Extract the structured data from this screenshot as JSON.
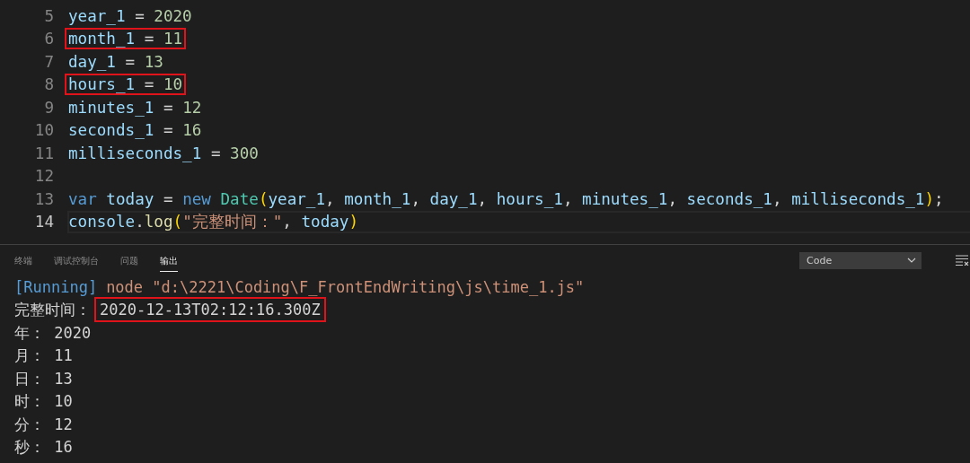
{
  "editor": {
    "lines": [
      {
        "number": "5",
        "highlighted": false,
        "current": false,
        "tokens": [
          {
            "kind": "var",
            "text": "year_1"
          },
          {
            "kind": "op",
            "text": " = "
          },
          {
            "kind": "num",
            "text": "2020"
          }
        ]
      },
      {
        "number": "6",
        "highlighted": true,
        "current": false,
        "tokens": [
          {
            "kind": "var",
            "text": "month_1"
          },
          {
            "kind": "op",
            "text": " = "
          },
          {
            "kind": "num",
            "text": "11"
          }
        ]
      },
      {
        "number": "7",
        "highlighted": false,
        "current": false,
        "tokens": [
          {
            "kind": "var",
            "text": "day_1"
          },
          {
            "kind": "op",
            "text": " = "
          },
          {
            "kind": "num",
            "text": "13"
          }
        ]
      },
      {
        "number": "8",
        "highlighted": true,
        "current": false,
        "tokens": [
          {
            "kind": "var",
            "text": "hours_1"
          },
          {
            "kind": "op",
            "text": " = "
          },
          {
            "kind": "num",
            "text": "10"
          }
        ]
      },
      {
        "number": "9",
        "highlighted": false,
        "current": false,
        "tokens": [
          {
            "kind": "var",
            "text": "minutes_1"
          },
          {
            "kind": "op",
            "text": " = "
          },
          {
            "kind": "num",
            "text": "12"
          }
        ]
      },
      {
        "number": "10",
        "highlighted": false,
        "current": false,
        "tokens": [
          {
            "kind": "var",
            "text": "seconds_1"
          },
          {
            "kind": "op",
            "text": " = "
          },
          {
            "kind": "num",
            "text": "16"
          }
        ]
      },
      {
        "number": "11",
        "highlighted": false,
        "current": false,
        "tokens": [
          {
            "kind": "var",
            "text": "milliseconds_1"
          },
          {
            "kind": "op",
            "text": " = "
          },
          {
            "kind": "num",
            "text": "300"
          }
        ]
      },
      {
        "number": "12",
        "current": false
      },
      {
        "number": "13",
        "highlighted": false,
        "current": false,
        "tokens": [
          {
            "kind": "kw",
            "text": "var"
          },
          {
            "kind": "var",
            "text": " today"
          },
          {
            "kind": "op",
            "text": " = "
          },
          {
            "kind": "kw",
            "text": "new"
          },
          {
            "kind": "cls",
            "text": " Date"
          },
          {
            "kind": "paren",
            "text": "("
          },
          {
            "kind": "var",
            "text": "year_1"
          },
          {
            "kind": "op",
            "text": ", "
          },
          {
            "kind": "var",
            "text": "month_1"
          },
          {
            "kind": "op",
            "text": ", "
          },
          {
            "kind": "var",
            "text": "day_1"
          },
          {
            "kind": "op",
            "text": ", "
          },
          {
            "kind": "var",
            "text": "hours_1"
          },
          {
            "kind": "op",
            "text": ", "
          },
          {
            "kind": "var",
            "text": "minutes_1"
          },
          {
            "kind": "op",
            "text": ", "
          },
          {
            "kind": "var",
            "text": "seconds_1"
          },
          {
            "kind": "op",
            "text": ", "
          },
          {
            "kind": "var",
            "text": "milliseconds_1"
          },
          {
            "kind": "paren",
            "text": ")"
          },
          {
            "kind": "op",
            "text": ";"
          }
        ]
      },
      {
        "number": "14",
        "highlighted": false,
        "current": true,
        "tokens": [
          {
            "kind": "var",
            "text": "console"
          },
          {
            "kind": "op",
            "text": "."
          },
          {
            "kind": "fn",
            "text": "log"
          },
          {
            "kind": "paren",
            "text": "("
          },
          {
            "kind": "str",
            "text": "\"完整时间：\""
          },
          {
            "kind": "op",
            "text": ", "
          },
          {
            "kind": "var",
            "text": "today"
          },
          {
            "kind": "paren",
            "text": ")"
          }
        ]
      }
    ]
  },
  "panel": {
    "tabs": [
      {
        "label": "终端",
        "selected": false
      },
      {
        "label": "调试控制台",
        "selected": false
      },
      {
        "label": "问题",
        "selected": false
      },
      {
        "label": "输出",
        "selected": true
      }
    ],
    "channel_select": {
      "value": "Code"
    },
    "output": [
      {
        "segments": [
          {
            "kind": "tag",
            "text": "[Running]",
            "highlighted": false
          },
          {
            "kind": "cmd",
            "text": "node \"d:\\2221\\Coding\\F_FrontEndWriting\\js\\time_1.js\"",
            "highlighted": false
          }
        ]
      },
      {
        "segments": [
          {
            "kind": "plain",
            "text": "完整时间：",
            "highlighted": false
          },
          {
            "kind": "plain",
            "text": "2020-12-13T02:12:16.300Z",
            "highlighted": true
          }
        ]
      },
      {
        "segments": [
          {
            "kind": "plain",
            "text": "年： 2020",
            "highlighted": false
          }
        ]
      },
      {
        "segments": [
          {
            "kind": "plain",
            "text": "月： 11",
            "highlighted": false
          }
        ]
      },
      {
        "segments": [
          {
            "kind": "plain",
            "text": "日： 13",
            "highlighted": false
          }
        ]
      },
      {
        "segments": [
          {
            "kind": "plain",
            "text": "时： 10",
            "highlighted": false
          }
        ]
      },
      {
        "segments": [
          {
            "kind": "plain",
            "text": "分： 12",
            "highlighted": false
          }
        ]
      },
      {
        "segments": [
          {
            "kind": "plain",
            "text": "秒： 16",
            "highlighted": false
          }
        ]
      }
    ]
  }
}
